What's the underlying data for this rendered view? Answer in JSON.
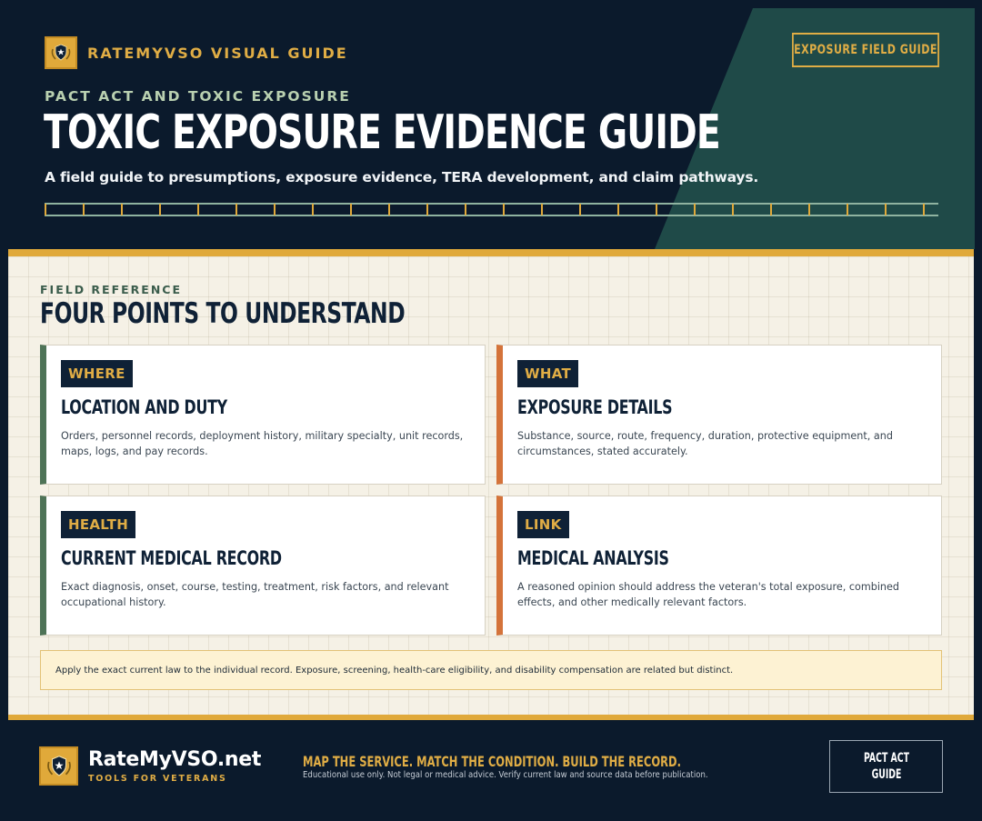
{
  "header": {
    "brand": "RATEMYVSO VISUAL GUIDE",
    "field_guide_button": "EXPOSURE FIELD GUIDE",
    "eyebrow": "PACT ACT AND TOXIC EXPOSURE",
    "title": "TOXIC EXPOSURE EVIDENCE GUIDE",
    "subtitle": "A field guide to presumptions, exposure evidence, TERA development, and claim pathways."
  },
  "content": {
    "section_label": "FIELD REFERENCE",
    "section_title": "FOUR POINTS TO UNDERSTAND",
    "cards": [
      {
        "tag": "WHERE",
        "title": "LOCATION AND DUTY",
        "body": "Orders, personnel records, deployment history, military specialty, unit records, maps, logs, and pay records."
      },
      {
        "tag": "WHAT",
        "title": "EXPOSURE DETAILS",
        "body": "Substance, source, route, frequency, duration, protective equipment, and circumstances, stated accurately."
      },
      {
        "tag": "HEALTH",
        "title": "CURRENT MEDICAL RECORD",
        "body": "Exact diagnosis, onset, course, testing, treatment, risk factors, and relevant occupational history."
      },
      {
        "tag": "LINK",
        "title": "MEDICAL ANALYSIS",
        "body": "A reasoned opinion should address the veteran's total exposure, combined effects, and other medically relevant factors."
      }
    ],
    "note": "Apply the exact current law to the individual record. Exposure, screening, health-care eligibility, and disability compensation are related but distinct."
  },
  "footer": {
    "site_name": "RateMyVSO.net",
    "tagline": "TOOLS FOR VETERANS",
    "slogan": "MAP THE SERVICE. MATCH THE CONDITION. BUILD THE RECORD.",
    "disclaimer": "Educational use only. Not legal or medical advice. Verify current law and source data before publication.",
    "button_line1": "PACT ACT",
    "button_line2": "GUIDE"
  },
  "icons": {
    "brand_badge": "shield-star-icon",
    "footer_badge": "shield-star-icon"
  },
  "colors": {
    "navy": "#0b1a2c",
    "gold": "#e0a93a",
    "teal": "#1f4a48",
    "green_accent": "#4e7357",
    "orange_accent": "#d4733a",
    "cream": "#f5f1e6",
    "note_bg": "#fdf2d3"
  }
}
